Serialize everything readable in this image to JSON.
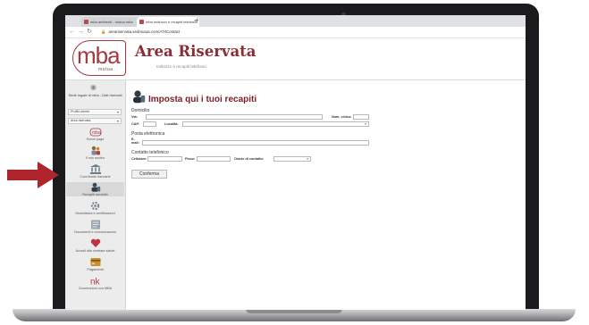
{
  "browser": {
    "tabs": [
      {
        "label": "mba ambienti - mutua mba"
      },
      {
        "label": "mba Indirizzo e recapiti telefonici"
      }
    ],
    "new_tab": "+",
    "url": "areariservata.sedmutua.com/ATI/Contact"
  },
  "header": {
    "logo_main": "mba",
    "logo_sub": "mutua",
    "title": "Area Riservata",
    "subtitle": "Indirizzo e recapiti telefonici"
  },
  "sidebar": {
    "user": "Sede legale di mba - Dati riservati",
    "select1": "Profilo utente",
    "select2": "Area riservata",
    "items": [
      {
        "label": "Home page",
        "icon": "mba-logo-icon"
      },
      {
        "label": "Il mio nucleo",
        "icon": "family-icon"
      },
      {
        "label": "Coordinate bancarie",
        "icon": "bank-icon"
      },
      {
        "label": "Recapiti assistito",
        "icon": "contact-icon",
        "active": true
      },
      {
        "label": "Modulistica e certificazioni",
        "icon": "gear-icon"
      },
      {
        "label": "Documenti e comunicazioni",
        "icon": "document-icon"
      },
      {
        "label": "Accedi alla centrale salute",
        "icon": "health-icon"
      },
      {
        "label": "Pagamenti",
        "icon": "payments-icon"
      },
      {
        "label": "Convenzioni con MBA",
        "icon": "nk-icon"
      }
    ]
  },
  "form": {
    "title": "Imposta qui i tuoi recapiti",
    "domicilio": {
      "heading": "Domicilio",
      "via_label": "Via:",
      "civico_label": "Num. civico:",
      "cap_label": "CAP:",
      "localita_label": "Località:"
    },
    "email": {
      "heading": "Posta elettronica",
      "label": "E-mail:"
    },
    "telefono": {
      "heading": "Contatto telefonico",
      "cellulare_label": "Cellulare:",
      "fisso_label": "Fisso:",
      "orario_label": "Orario di contatto:"
    },
    "confirm": "Conferma"
  },
  "colors": {
    "brand": "#a53840",
    "title": "#7a1e25",
    "arrow": "#b0242c"
  }
}
